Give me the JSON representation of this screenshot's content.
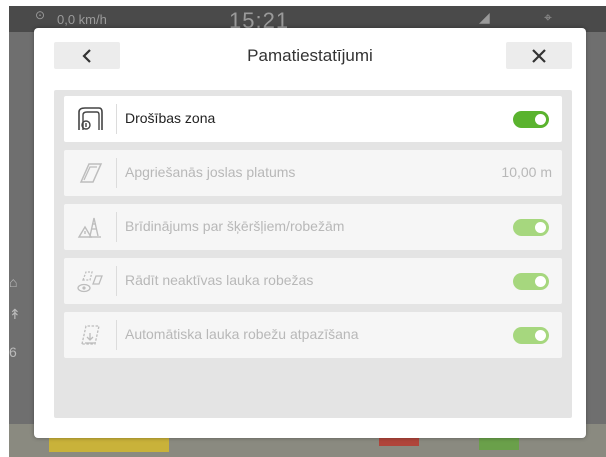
{
  "status_bar": {
    "speed": "0,0 km/h",
    "time": "15:21"
  },
  "dialog": {
    "title": "Pamatiestatījumi",
    "back_icon": "chevron-left-icon",
    "close_icon": "close-icon"
  },
  "settings": [
    {
      "label": "Drošības zona",
      "icon": "safety-zone-icon",
      "control": "toggle",
      "state": "on",
      "enabled": true
    },
    {
      "label": "Apgriešanās joslas platums",
      "icon": "headland-width-icon",
      "control": "value",
      "value": "10,00 m",
      "enabled": false
    },
    {
      "label": "Brīdinājums par šķēršļiem/robežām",
      "icon": "obstacle-warning-icon",
      "control": "toggle",
      "state": "on",
      "enabled": false
    },
    {
      "label": "Rādīt neaktīvas lauka robežas",
      "icon": "inactive-boundaries-icon",
      "control": "toggle",
      "state": "on",
      "enabled": false
    },
    {
      "label": "Automātiska lauka robežu atpazīšana",
      "icon": "auto-boundary-icon",
      "control": "toggle",
      "state": "on",
      "enabled": false
    }
  ],
  "colors": {
    "toggle_on": "#5ab32e",
    "toggle_disabled": "#a6d77e"
  }
}
